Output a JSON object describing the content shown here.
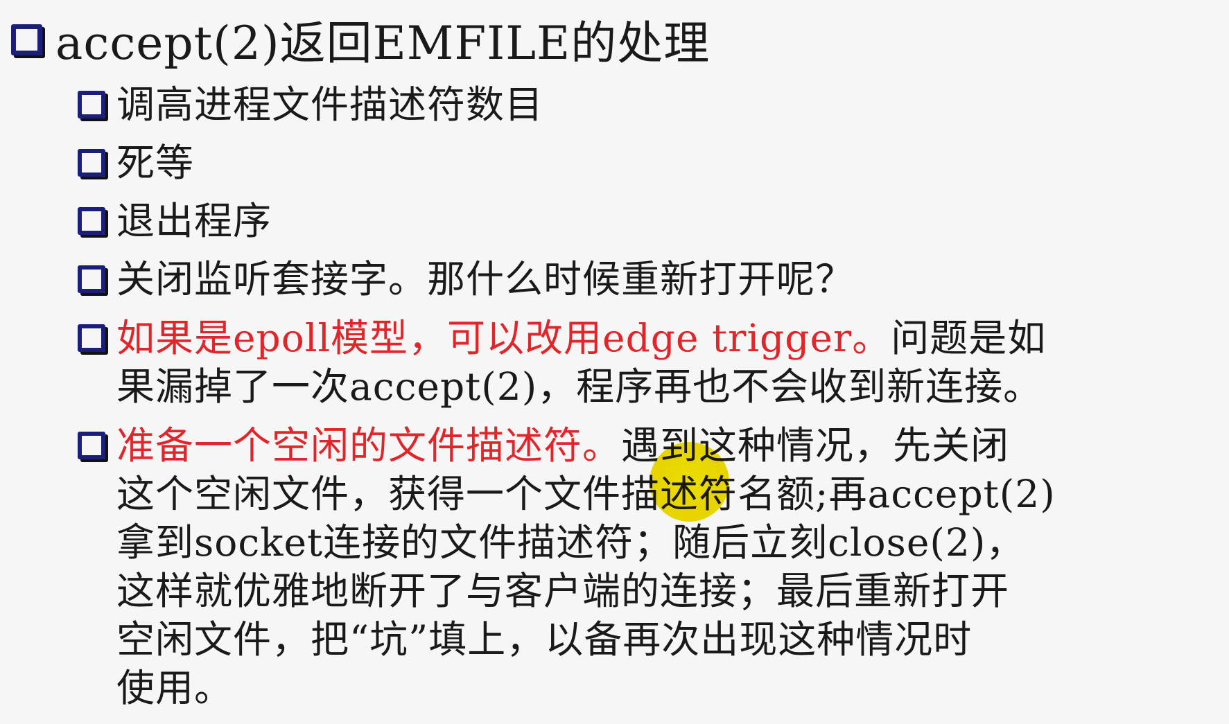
{
  "title": "accept(2)返回EMFILE的处理",
  "items": [
    {
      "text": "调高进程文件描述符数目"
    },
    {
      "text": "死等"
    },
    {
      "text": "退出程序"
    },
    {
      "text": "关闭监听套接字。那什么时候重新打开呢？"
    },
    {
      "red_text": "如果是epoll模型，可以改用edge trigger。",
      "line1_rest": "问题是如",
      "line2": "果漏掉了一次accept(2)，程序再也不会收到新连接。"
    },
    {
      "red_text": "准备一个空闲的文件描述符。",
      "line1_rest": "遇到这种情况，先关闭",
      "line2": "这个空闲文件，获得一个文件描述符名额;再accept(2)",
      "line3": "拿到socket连接的文件描述符；随后立刻close(2)，",
      "line4": "这样就优雅地断开了与客户端的连接；最后重新打开",
      "line5": "空闲文件，把“坑”填上，以备再次出现这种情况时",
      "line6": "使用。"
    }
  ],
  "colors": {
    "text": "#1a1a1a",
    "highlight_red": "#e0262a",
    "checkbox_blue": "#1b1f7a",
    "pointer_yellow": "#f0dc00",
    "background": "#f6f6f6"
  },
  "icons": {
    "bullet": "checkbox-icon",
    "cursor": "laser-pointer-icon"
  }
}
